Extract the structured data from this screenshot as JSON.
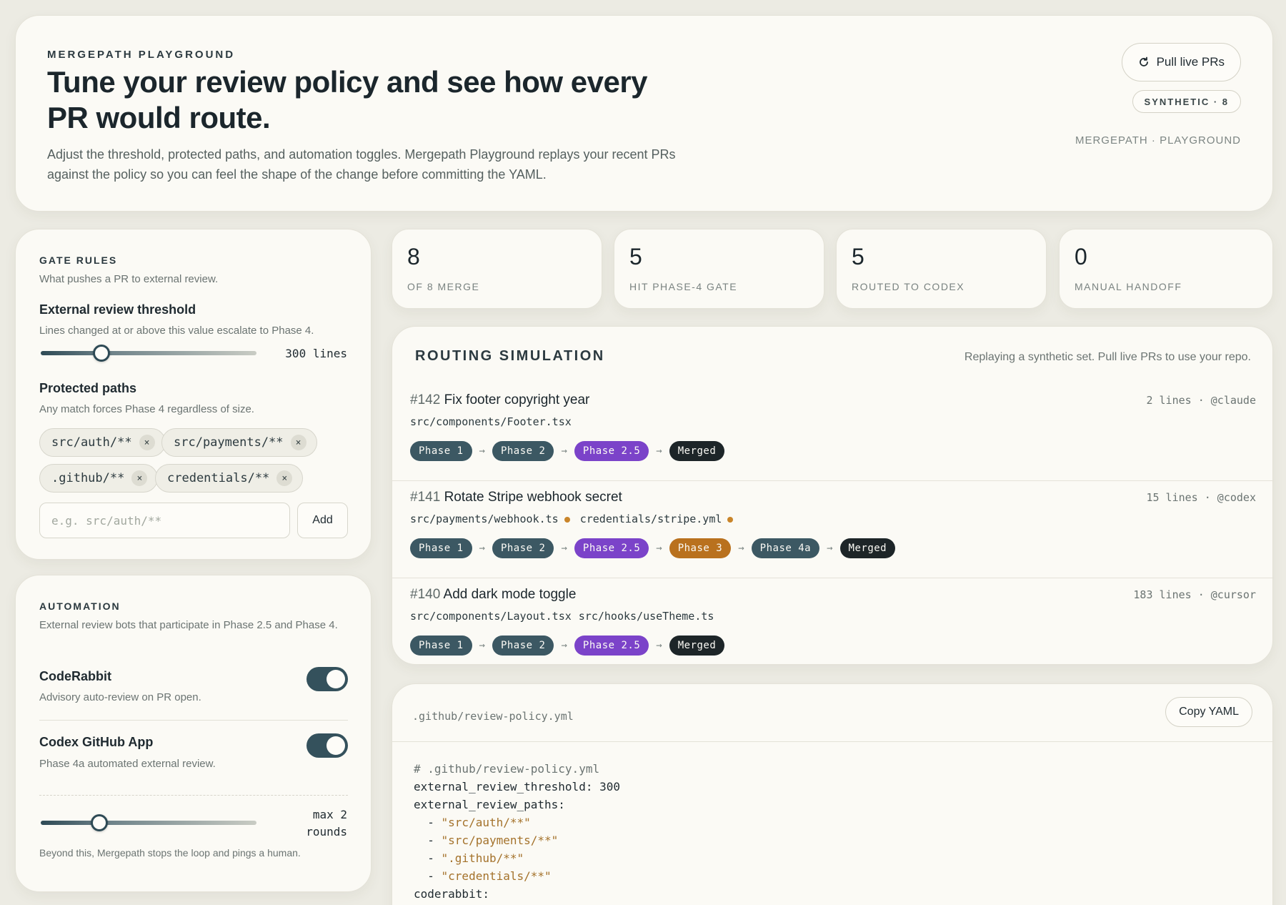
{
  "header": {
    "eyebrow": "MERGEPATH PLAYGROUND",
    "title": "Tune your review policy and see how every PR would route.",
    "description": "Adjust the threshold, protected paths, and automation toggles. Mergepath Playground replays your recent PRs against the policy so you can feel the shape of the change before committing the YAML.",
    "pull_button": "Pull live PRs",
    "badge": "SYNTHETIC · 8",
    "meta": "MERGEPATH · PLAYGROUND"
  },
  "gate": {
    "title": "GATE RULES",
    "subtitle": "What pushes a PR to external review.",
    "threshold_label": "External review threshold",
    "threshold_help": "Lines changed at or above this value escalate to Phase 4.",
    "threshold_value": "300 lines",
    "threshold_fraction": 0.28,
    "paths_label": "Protected paths",
    "paths_help": "Any match forces Phase 4 regardless of size.",
    "paths": [
      "src/auth/**",
      "src/payments/**",
      ".github/**",
      "credentials/**"
    ],
    "chip_remove": "×",
    "input_placeholder": "e.g. src/auth/**",
    "add_button": "Add"
  },
  "automation": {
    "title": "AUTOMATION",
    "subtitle": "External review bots that participate in Phase 2.5 and Phase 4.",
    "bots": [
      {
        "name": "CodeRabbit",
        "desc": "Advisory auto-review on PR open.",
        "enabled": true
      },
      {
        "name": "Codex GitHub App",
        "desc": "Phase 4a automated external review.",
        "enabled": true
      }
    ],
    "rounds_line1": "max 2",
    "rounds_line2": "rounds",
    "rounds_fraction": 0.27,
    "rounds_help": "Beyond this, Mergepath stops the loop and pings a human."
  },
  "stats": [
    {
      "value": "8",
      "label": "OF 8 MERGE"
    },
    {
      "value": "5",
      "label": "HIT PHASE-4 GATE"
    },
    {
      "value": "5",
      "label": "ROUTED TO CODEX"
    },
    {
      "value": "0",
      "label": "MANUAL HANDOFF"
    }
  ],
  "routing": {
    "title": "ROUTING SIMULATION",
    "note": "Replaying a synthetic set. Pull live PRs to use your repo.",
    "arrow": "→",
    "prs": [
      {
        "number": "#142",
        "title": "Fix footer copyright year",
        "meta": "2 lines · @claude",
        "files": [
          "src/components/Footer.tsx"
        ],
        "phases": [
          "Phase 1",
          "Phase 2",
          "Phase 2.5",
          "Merged"
        ]
      },
      {
        "number": "#141",
        "title": "Rotate Stripe webhook secret",
        "meta": "15 lines · @codex",
        "files": [
          "src/payments/webhook.ts",
          "credentials/stripe.yml"
        ],
        "phases": [
          "Phase 1",
          "Phase 2",
          "Phase 2.5",
          "Phase 3",
          "Phase 4a",
          "Merged"
        ]
      },
      {
        "number": "#140",
        "title": "Add dark mode toggle",
        "meta": "183 lines · @cursor",
        "files": [
          "src/components/Layout.tsx",
          "src/hooks/useTheme.ts"
        ],
        "phases": [
          "Phase 1",
          "Phase 2",
          "Phase 2.5",
          "Merged"
        ]
      }
    ]
  },
  "yaml": {
    "filename": ".github/review-policy.yml",
    "copy_button": "Copy YAML",
    "lines": [
      {
        "type": "comment",
        "text": "# .github/review-policy.yml"
      },
      {
        "type": "plain",
        "text": "external_review_threshold: 300"
      },
      {
        "type": "plain",
        "text": "external_review_paths:"
      },
      {
        "type": "item",
        "text": "\"src/auth/**\""
      },
      {
        "type": "item",
        "text": "\"src/payments/**\""
      },
      {
        "type": "item",
        "text": "\".github/**\""
      },
      {
        "type": "item",
        "text": "\"credentials/**\""
      },
      {
        "type": "plain",
        "text": "coderabbit:"
      }
    ]
  },
  "colors": {
    "accent": "#34515c",
    "phase_violet": "#7b43c9",
    "phase_amber": "#b9711e",
    "phase_ink": "#1d2528",
    "sensitive_dot": "#c9852a"
  }
}
